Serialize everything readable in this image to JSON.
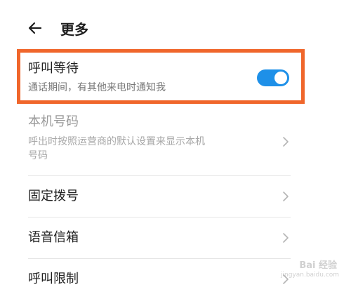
{
  "header": {
    "back_icon": "arrow-left-icon",
    "title": "更多"
  },
  "call_waiting": {
    "title": "呼叫等待",
    "subtitle": "通话期间，有其他来电时通知我",
    "enabled": true,
    "toggle_color": "#1e90e8",
    "highlight_color": "#f0662b"
  },
  "display_number": {
    "title": "本机号码",
    "subtitle_line1": "呼出时按照运营商的默认设置来显示本机",
    "subtitle_line2": "号码"
  },
  "menu": [
    {
      "label": "固定拨号"
    },
    {
      "label": "语音信箱"
    },
    {
      "label": "呼叫限制"
    }
  ],
  "watermark": {
    "text": "Bai 经验",
    "url": "jingyan.baidu.com"
  }
}
